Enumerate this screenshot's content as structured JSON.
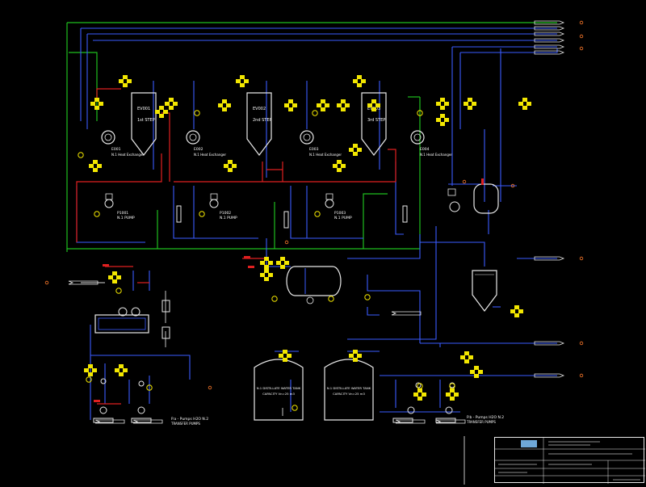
{
  "colors": {
    "background": "#000000",
    "pipe_green": "#1fbf1f",
    "pipe_blue": "#3a5bff",
    "pipe_red": "#e02020",
    "pipe_white": "#e8e8e8",
    "instrument_yellow": "#f2e600",
    "text_white": "#ffffff"
  },
  "evaporators": [
    {
      "tag": "EV001",
      "label": "1st STEP"
    },
    {
      "tag": "EV002",
      "label": "2nd STEP"
    },
    {
      "tag": "EV003",
      "label": "3rd STEP"
    }
  ],
  "heat_exchangers": [
    {
      "tag": "E001",
      "label": "N.1 Heat Exchanger"
    },
    {
      "tag": "E002",
      "label": "N.1 Heat Exchanger"
    },
    {
      "tag": "E003",
      "label": "N.1 Heat Exchanger"
    },
    {
      "tag": "E004",
      "label": "N.1 Heat Exchanger"
    }
  ],
  "pumps": [
    {
      "tag": "P1001",
      "label": "N.1 PUMP"
    },
    {
      "tag": "P1002",
      "label": "N.1 PUMP"
    },
    {
      "tag": "P1003",
      "label": "N.1 PUMP"
    }
  ],
  "tanks": [
    {
      "label": "N.1 DISTILLATE WATER TANK",
      "capacity": "CAPACITY Vn=25 m3"
    },
    {
      "label": "N.1 DISTILLATE WATER TANK",
      "capacity": "CAPACITY Vn=25 m3"
    }
  ],
  "pump_groups": [
    {
      "label": "P.a - Pumps H2O N.2",
      "note": "TRANSFER PUMPS"
    },
    {
      "label": "P.b - Pumps H2O N.2",
      "note": "TRANSFER PUMPS"
    }
  ],
  "title_block": {
    "company": "",
    "drawing_title": "",
    "drawing_number": ""
  }
}
